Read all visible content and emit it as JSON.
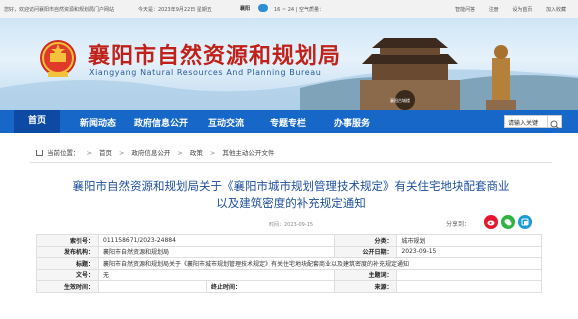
{
  "topbar": {
    "welcome": "您好，欢迎访问襄阳市自然资源和规划局门户网站",
    "date": "今天是：2023年9月22日 星期五",
    "city": "襄阳",
    "weather": "16 ~ 24 | 空气质量：",
    "links": [
      "智能问答",
      "注册",
      "设为首页",
      "加入收藏"
    ]
  },
  "header": {
    "title_cn": "襄阳市自然资源和规划局",
    "title_en": "Xiangyang Natural Resources And Planning Bureau",
    "photo_caption": "襄阳古城楼"
  },
  "nav": {
    "items": [
      "首页",
      "新闻动态",
      "政府信息公开",
      "互动交流",
      "专题专栏",
      "办事服务"
    ],
    "search_value": "请输入关键"
  },
  "breadcrumb": {
    "label": "当前位置：",
    "items": [
      "首页",
      "政府信息公开",
      "政策",
      "其他主动公开文件"
    ]
  },
  "article": {
    "title_line1": "襄阳市自然资源和规划局关于《襄阳市城市规划管理技术规定》有关住宅地块配套商业",
    "title_line2": "以及建筑密度的补充规定通知",
    "date": "时间：2023-09-15",
    "share_label": "分享到："
  },
  "info": {
    "index_label": "索引号：",
    "index_value": "011158671/2023-24884",
    "category_label": "分类：",
    "category_value": "城市规划",
    "issuer_label": "发布机构：",
    "issuer_value": "襄阳市自然资源和规划局",
    "pubdate_label": "公开日期：",
    "pubdate_value": "2023-09-15",
    "title_label": "标题：",
    "title_value": "襄阳市自然资源和规划局关于《襄阳市城市规划管理技术规定》有关住宅地块配套商业以及建筑密度的补充规定通知",
    "docno_label": "文号：",
    "docno_value": "无",
    "keyword_label": "主题词：",
    "keyword_value": "",
    "effective_label": "生效时间：",
    "effective_value": "",
    "expire_label": "终止时间：",
    "expire_value": "",
    "source_label": "来源：",
    "source_value": ""
  },
  "colors": {
    "nav_bg": "#1667c7",
    "title_red": "#c0221a",
    "article_title": "#1e4f9f"
  }
}
